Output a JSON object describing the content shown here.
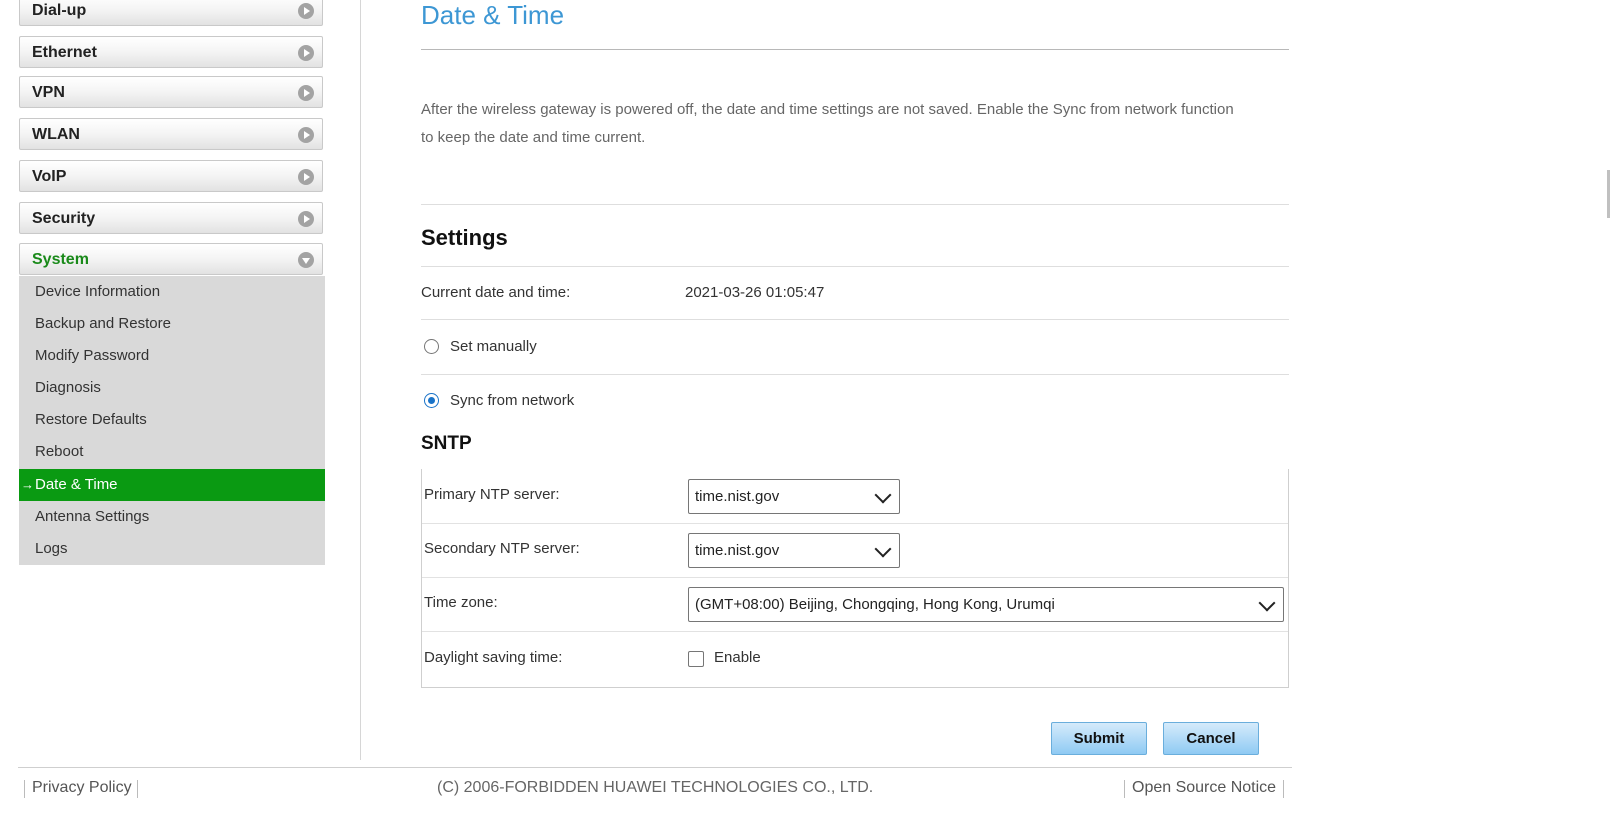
{
  "sidebar": {
    "menu": [
      {
        "label": "Dial-up"
      },
      {
        "label": "Ethernet"
      },
      {
        "label": "VPN"
      },
      {
        "label": "WLAN"
      },
      {
        "label": "VoIP"
      },
      {
        "label": "Security"
      },
      {
        "label": "System"
      }
    ],
    "submenu": [
      {
        "label": "Device Information"
      },
      {
        "label": "Backup and Restore"
      },
      {
        "label": "Modify Password"
      },
      {
        "label": "Diagnosis"
      },
      {
        "label": "Restore Defaults"
      },
      {
        "label": "Reboot"
      },
      {
        "label": "Date & Time",
        "active": true
      },
      {
        "label": "Antenna Settings"
      },
      {
        "label": "Logs"
      }
    ],
    "active_marker": "→"
  },
  "main": {
    "title": "Date & Time",
    "description": "After the wireless gateway is powered off, the date and time settings are not saved. Enable the Sync from network function to keep the date and time current.",
    "settings_title": "Settings",
    "current_label": "Current date and time:",
    "current_value": "2021-03-26 01:05:47",
    "radio_manual": "Set manually",
    "radio_sync": "Sync from network",
    "selected_mode": "Sync from network",
    "sntp_title": "SNTP",
    "primary_label": "Primary NTP server:",
    "primary_value": "time.nist.gov",
    "secondary_label": "Secondary NTP server:",
    "secondary_value": "time.nist.gov",
    "timezone_label": "Time zone:",
    "timezone_value": "(GMT+08:00) Beijing, Chongqing, Hong Kong, Urumqi",
    "dst_label": "Daylight saving time:",
    "dst_option": "Enable",
    "dst_checked": false,
    "submit": "Submit",
    "cancel": "Cancel"
  },
  "footer": {
    "privacy": "Privacy Policy",
    "copyright": "(C) 2006-FORBIDDEN HUAWEI TECHNOLOGIES CO., LTD.",
    "open_source": "Open Source Notice"
  },
  "colors": {
    "title_blue": "#3d97d4",
    "active_green": "#0a9a12",
    "system_green": "#1a8a1a",
    "button_blue": "#8fcaf3"
  }
}
